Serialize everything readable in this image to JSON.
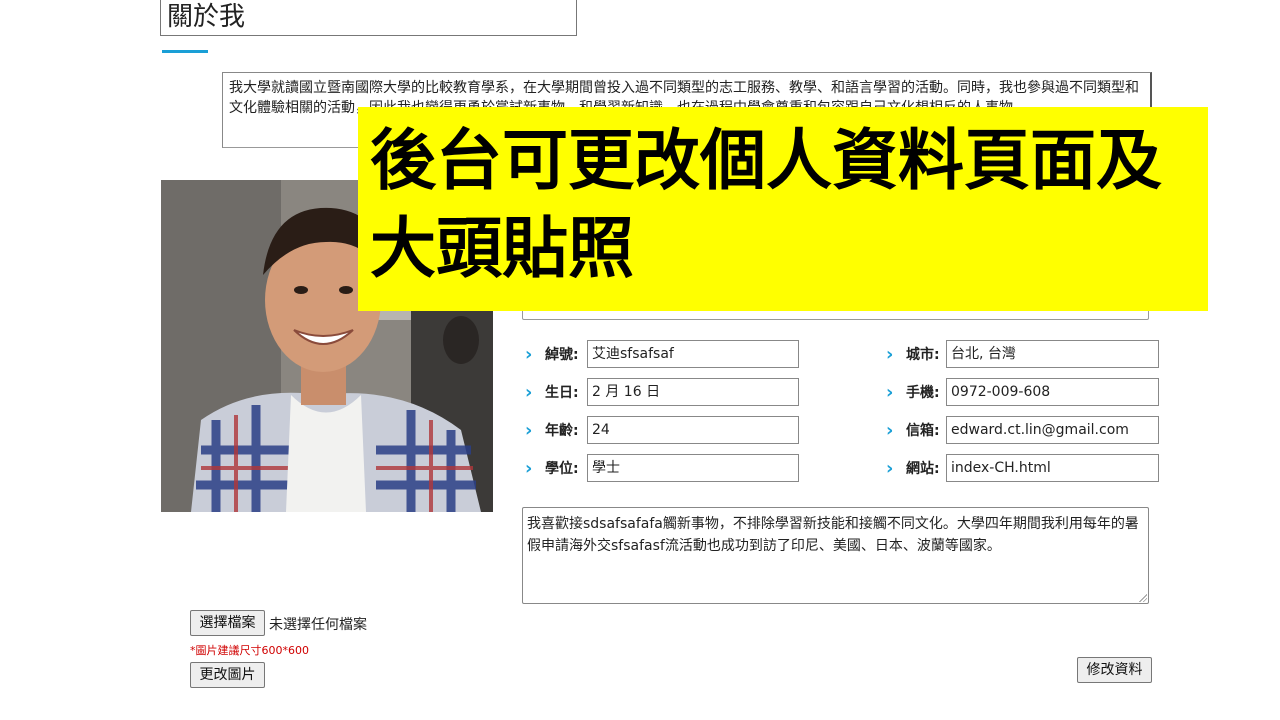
{
  "header": {
    "title": "關於我",
    "accent_color": "#1a9fd6"
  },
  "about": {
    "text": "我大學就讀國立暨南國際大學的比較教育學系，在大學期間曾投入過不同類型的志工服務、教學、和語言學習的活動。同時，我也參與過不同類型和文化體驗相關的活動，因此我也變得更勇於嘗試新事物，和學習新知識，也在過程中學會尊重和包容跟自己文化想相反的人事物。"
  },
  "avatar": {
    "description": "portrait-photo"
  },
  "overlay": {
    "text": "後台可更改個人資料頁面及大頭貼照",
    "background": "#ffff00"
  },
  "fields": {
    "nickname": {
      "label": "綽號:",
      "value": "艾迪sfsafsaf"
    },
    "birthday": {
      "label": "生日:",
      "value": "2 月 16 日"
    },
    "age": {
      "label": "年齡:",
      "value": "24"
    },
    "degree": {
      "label": "學位:",
      "value": "學士"
    },
    "city": {
      "label": "城市:",
      "value": "台北, 台灣"
    },
    "mobile": {
      "label": "手機:",
      "value": "0972-009-608"
    },
    "email": {
      "label": "信箱:",
      "value": "edward.ct.lin@gmail.com"
    },
    "website": {
      "label": "網站:",
      "value": "index-CH.html"
    }
  },
  "story": {
    "text": "我喜歡接sdsafsafafa觸新事物，不排除學習新技能和接觸不同文化。大學四年期間我利用每年的暑假申請海外交sfsafasf流活動也成功到訪了印尼、美國、日本、波蘭等國家。"
  },
  "upload": {
    "choose_label": "選擇檔案",
    "no_file": "未選擇任何檔案",
    "hint": "*圖片建議尺寸600*600",
    "change_label": "更改圖片"
  },
  "actions": {
    "save_label": "修改資料"
  }
}
